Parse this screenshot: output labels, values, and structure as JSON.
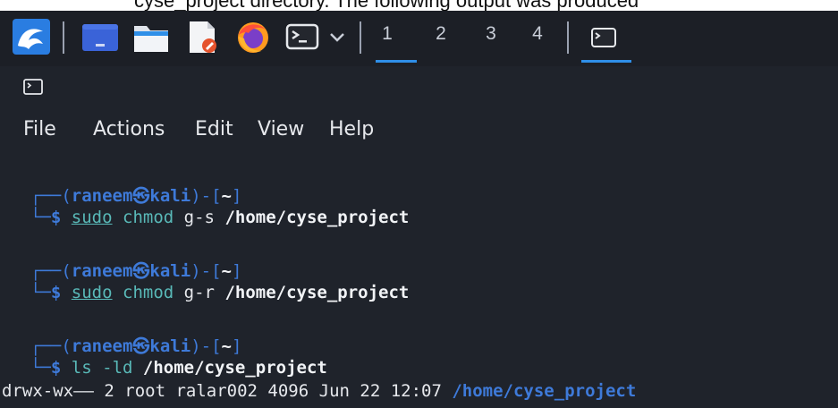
{
  "caption_fragment": "cyse_project directory. The following output was produced",
  "panel": {
    "icons": [
      "kali-dragon-icon",
      "desktop-icon",
      "file-manager-icon",
      "text-editor-icon",
      "firefox-icon",
      "terminal-icon",
      "chevron-down-icon",
      "active-terminal-icon"
    ],
    "workspaces": [
      "1",
      "2",
      "3",
      "4"
    ],
    "active_workspace": "1",
    "accent_color": "#2f8fe8"
  },
  "terminal": {
    "menu": [
      "File",
      "Actions",
      "Edit",
      "View",
      "Help"
    ],
    "prompt": {
      "top_open": "┌──(",
      "user": "raneem",
      "at": "㉿",
      "host": "kali",
      "mid": ")-[",
      "path": "~",
      "close": "]",
      "bottom": "└─",
      "dollar": "$"
    },
    "commands": [
      {
        "cmd": "sudo",
        "rest1": "chmod",
        "rest2": "g-s",
        "target": "/home/cyse_project"
      },
      {
        "cmd": "sudo",
        "rest1": "chmod",
        "rest2": "g-r",
        "target": "/home/cyse_project"
      },
      {
        "cmd": "ls",
        "rest1": "-ld",
        "rest2": "",
        "target": "/home/cyse_project"
      }
    ],
    "output": {
      "perms": "drwx-wx——",
      "info": "2 root ralar002 4096 Jun 22 12:07",
      "path": "/home/cyse_project"
    },
    "colors": {
      "prompt_blue": "#3e7ad9",
      "command_teal": "#59b9b8",
      "background": "#1f232b"
    }
  }
}
